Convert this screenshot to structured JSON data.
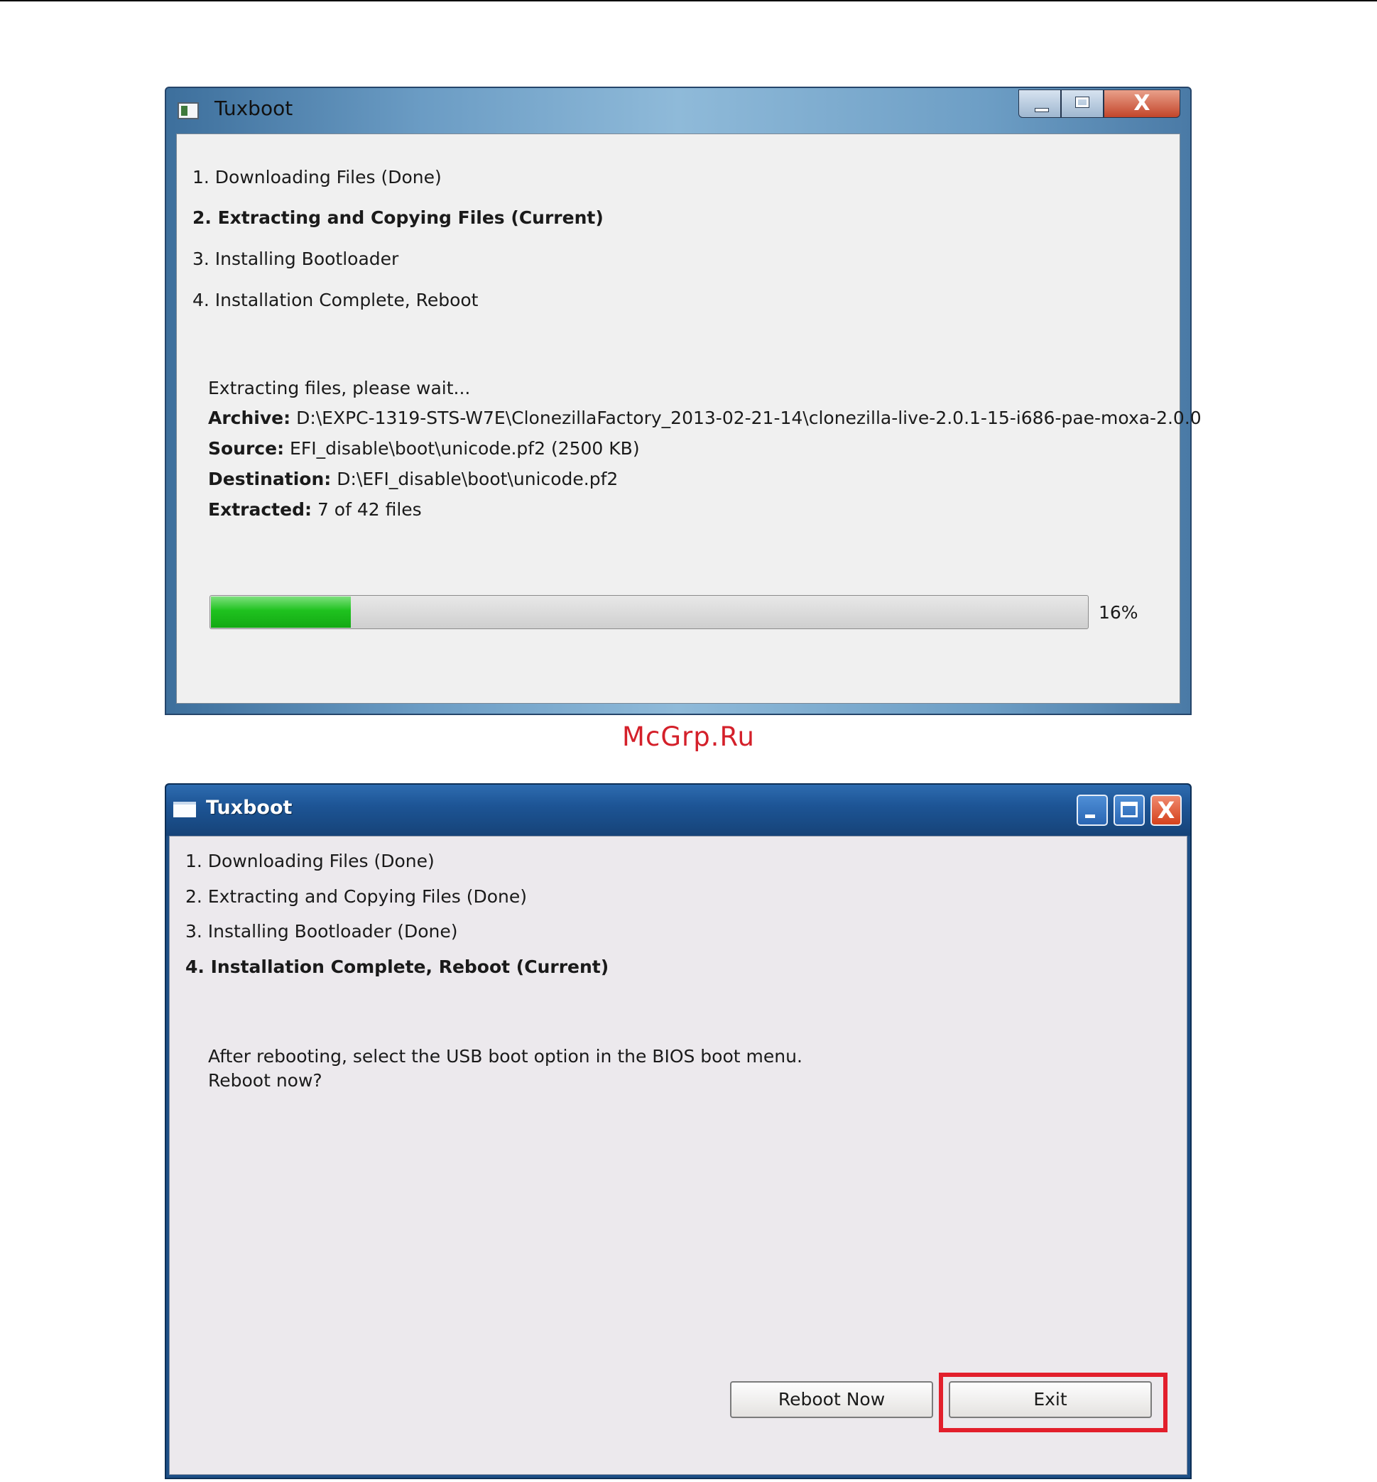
{
  "window1": {
    "title": "Tuxboot",
    "icon": "app-window-icon",
    "caption_buttons": [
      "minimize-icon",
      "maximize-icon",
      "close-icon"
    ],
    "close_glyph": "X",
    "steps": [
      {
        "label": "1. Downloading Files (Done)",
        "current": false
      },
      {
        "label": "2. Extracting and Copying Files (Current)",
        "current": true
      },
      {
        "label": "3. Installing Bootloader",
        "current": false
      },
      {
        "label": "4. Installation Complete, Reboot",
        "current": false
      }
    ],
    "status": "Extracting files, please wait...",
    "archive_label": "Archive:",
    "archive_value": "D:\\EXPC-1319-STS-W7E\\ClonezillaFactory_2013-02-21-14\\clonezilla-live-2.0.1-15-i686-pae-moxa-2.0.0",
    "source_label": "Source:",
    "source_value": "EFI_disable\\boot\\unicode.pf2 (2500 KB)",
    "destination_label": "Destination:",
    "destination_value": "D:\\EFI_disable\\boot\\unicode.pf2",
    "extracted_label": "Extracted:",
    "extracted_value": "7 of 42 files",
    "progress_percent": 16,
    "progress_text": "16%",
    "progress_color": "#1fc21f"
  },
  "watermark": "McGrp.Ru",
  "window2": {
    "title": "Tuxboot",
    "icon": "app-window-icon",
    "caption_buttons": [
      "minimize-icon",
      "maximize-icon",
      "close-icon"
    ],
    "close_glyph": "X",
    "steps": [
      {
        "label": "1. Downloading Files (Done)",
        "current": false
      },
      {
        "label": "2. Extracting and Copying Files (Done)",
        "current": false
      },
      {
        "label": "3. Installing Bootloader (Done)",
        "current": false
      },
      {
        "label": "4. Installation Complete, Reboot (Current)",
        "current": true
      }
    ],
    "message_line1": "After rebooting, select the USB boot option in the BIOS boot menu.",
    "message_line2": "Reboot now?",
    "reboot_button": "Reboot Now",
    "exit_button": "Exit",
    "highlight_color": "#e21f2c"
  }
}
